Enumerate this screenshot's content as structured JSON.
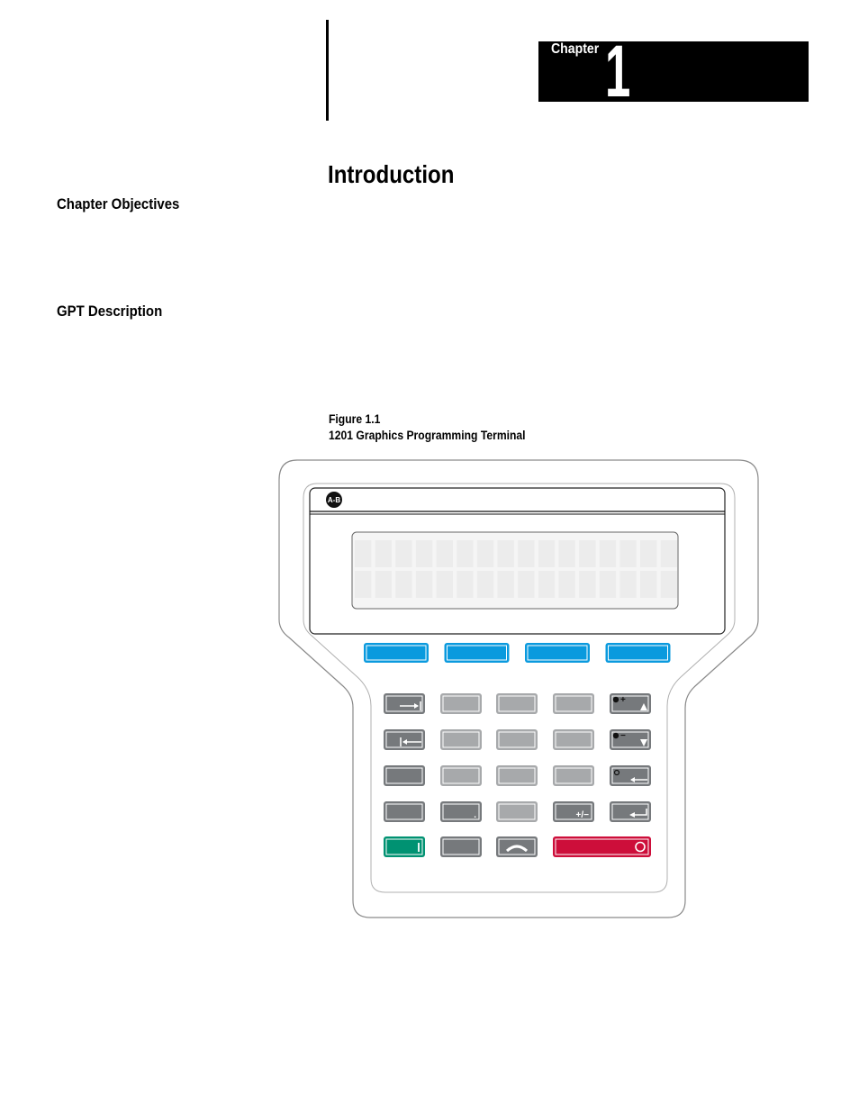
{
  "header": {
    "chapter_label": "Chapter",
    "chapter_number": "1"
  },
  "page_title": "Introduction",
  "sections": [
    {
      "heading": "Chapter Objectives"
    },
    {
      "heading": "GPT Description"
    }
  ],
  "figure": {
    "number": "Figure 1.1",
    "caption": "1201 Graphics Programming Terminal",
    "logo_text": "A-B",
    "display": {
      "rows": 2,
      "columns": 16
    },
    "function_keys": 4,
    "colors": {
      "function_key": "#0a9ade",
      "dark_key": "#76797c",
      "light_key": "#a7a9ab",
      "start_key": "#009272",
      "stop_key": "#cd0e3a",
      "lcd_cell": "#ececec",
      "lcd_bg": "#f5f5f5"
    },
    "keypad": [
      [
        {
          "type": "dark",
          "icon": "tab-right-icon"
        },
        {
          "type": "light"
        },
        {
          "type": "light"
        },
        {
          "type": "light"
        },
        {
          "type": "dark",
          "icon": "contrast-up-icon"
        }
      ],
      [
        {
          "type": "dark",
          "icon": "tab-left-icon"
        },
        {
          "type": "light"
        },
        {
          "type": "light"
        },
        {
          "type": "light"
        },
        {
          "type": "dark",
          "icon": "contrast-down-icon"
        }
      ],
      [
        {
          "type": "dark"
        },
        {
          "type": "light"
        },
        {
          "type": "light"
        },
        {
          "type": "light"
        },
        {
          "type": "dark",
          "icon": "backlight-backspace-icon"
        }
      ],
      [
        {
          "type": "dark"
        },
        {
          "type": "dark",
          "label": "."
        },
        {
          "type": "light"
        },
        {
          "type": "dark",
          "label": "+/−"
        },
        {
          "type": "dark",
          "icon": "enter-icon"
        }
      ],
      [
        {
          "type": "start",
          "icon": "start-bar-icon"
        },
        {
          "type": "dark"
        },
        {
          "type": "dark",
          "icon": "jog-arc-icon"
        },
        {
          "type": "stop",
          "icon": "stop-circle-icon",
          "span": 2
        }
      ]
    ]
  }
}
